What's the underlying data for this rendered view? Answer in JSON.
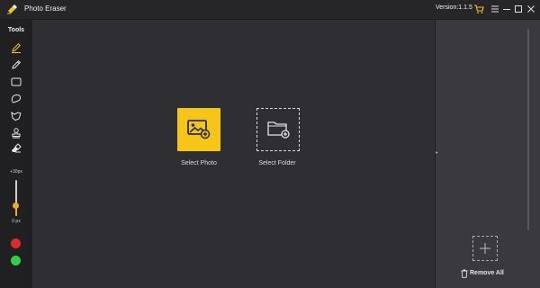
{
  "window": {
    "title": "Photo Eraser",
    "version": "Version:1.1.5"
  },
  "tools": {
    "label": "Tools",
    "items": [
      "marker-icon",
      "pencil-icon",
      "rectangle-select-icon",
      "lasso-icon",
      "polygon-lasso-icon",
      "stamp-icon",
      "eraser-icon"
    ],
    "brush_size_max": "+30px",
    "brush_size_min": "0 px",
    "brush_size_level": 0.3,
    "colors": [
      "#e02a2a",
      "#2fd04a"
    ]
  },
  "canvas": {
    "select_photo_label": "Select Photo",
    "select_folder_label": "Select Folder"
  },
  "right_panel": {
    "remove_all_label": "Remove All"
  },
  "colors": {
    "accent": "#f5c518",
    "slider": "#f5a623",
    "titlebar": "#262629",
    "sidebar": "#202023",
    "canvas": "#2e2e33",
    "panel": "#3a3a3e"
  }
}
